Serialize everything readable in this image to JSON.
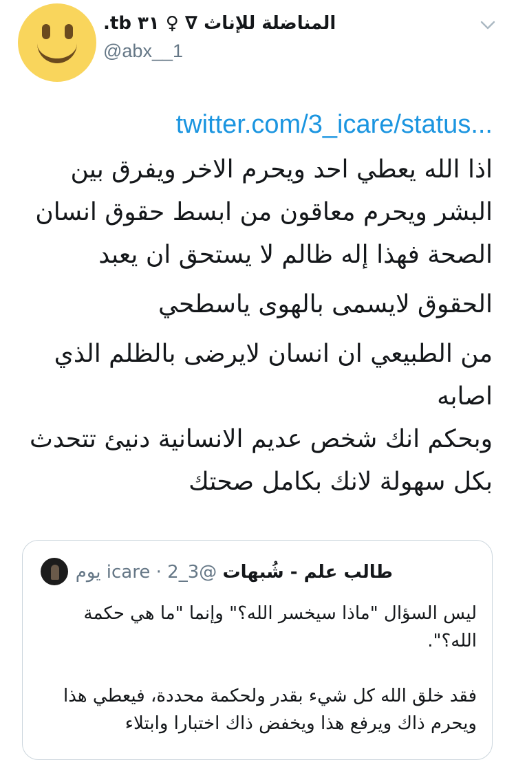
{
  "tweet": {
    "author": {
      "display_name": "المناضلة للإناث ∇ ♀ ٣١ tb.",
      "handle": "@abx__1",
      "avatar_icon": "smiley-face-icon",
      "avatar_color": "#f9d55c"
    },
    "link": "twitter.com/3_icare/status...",
    "paragraphs": [
      "اذا الله يعطي احد ويحرم الاخر ويفرق بين البشر ويحرم معاقون من ابسط حقوق انسان الصحة فهذا إله ظالم لا يستحق ان يعبد",
      "الحقوق لايسمى بالهوى ياسطحي",
      "من الطبيعي ان انسان لايرضى بالظلم الذي اصابه",
      "وبحكم انك شخص عديم الانسانية دنيئ تتحدث بكل سهولة لانك بكامل صحتك"
    ],
    "link_color": "#1b95e0"
  },
  "quoted": {
    "name": "طالب علم - شُبهات",
    "handle": "@3_icare",
    "separator": "·",
    "time": "2 يوم",
    "paragraphs": [
      "ليس السؤال \"ماذا سيخسر الله؟\" وإنما \"ما هي حكمة الله؟\".",
      "فقد خلق الله كل شيء بقدر ولحكمة محددة، فيعطي هذا ويحرم ذاك ويرفع هذا ويخفض ذاك اختبارا وابتلاء"
    ]
  }
}
